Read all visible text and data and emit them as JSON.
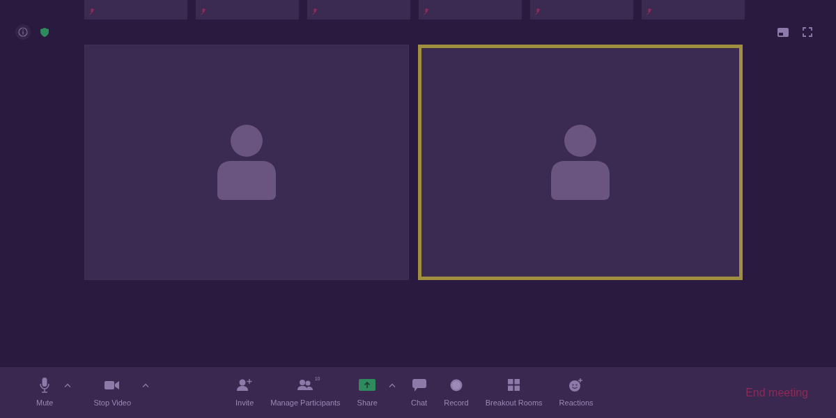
{
  "thumbnails": [
    {
      "muted": true
    },
    {
      "muted": true
    },
    {
      "muted": true
    },
    {
      "muted": true
    },
    {
      "muted": true
    },
    {
      "muted": true
    }
  ],
  "tiles": [
    {
      "active_speaker": false
    },
    {
      "active_speaker": true
    }
  ],
  "toolbar": {
    "left_buttons": [
      {
        "kind": "mic",
        "label": "Mute",
        "has_menu": true
      },
      {
        "kind": "video",
        "label": "Stop Video",
        "has_menu": true
      }
    ],
    "center_buttons": [
      {
        "kind": "invite",
        "label": "Invite",
        "has_menu": false
      },
      {
        "kind": "participants",
        "label": "Manage Participants",
        "has_menu": false,
        "count": "10"
      },
      {
        "kind": "share",
        "label": "Share",
        "has_menu": true
      },
      {
        "kind": "chat",
        "label": "Chat",
        "has_menu": false
      },
      {
        "kind": "record",
        "label": "Record",
        "has_menu": false
      },
      {
        "kind": "rooms",
        "label": "Breakout Rooms",
        "has_menu": false
      },
      {
        "kind": "reactions",
        "label": "Reactions",
        "has_menu": false
      }
    ],
    "end_button": "End meeting"
  }
}
